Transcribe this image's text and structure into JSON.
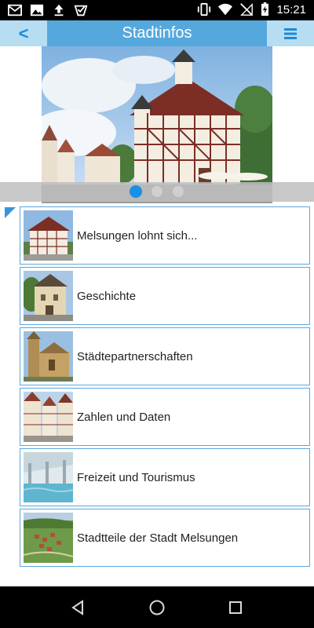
{
  "status_bar": {
    "time": "15:21",
    "left_icons": [
      "gmail-icon",
      "image-icon",
      "upload-icon",
      "check-badge-icon"
    ],
    "right_icons": [
      "vibrate-icon",
      "wifi-icon",
      "no-sim-icon",
      "battery-charging-icon"
    ]
  },
  "header": {
    "title": "Stadtinfos",
    "back_label": "<",
    "accent_color": "#55a8dc"
  },
  "slider": {
    "dot_count": 3,
    "active_index": 0
  },
  "list": {
    "items": [
      {
        "label": "Melsungen lohnt sich...",
        "thumb": "rathaus-thumbnail"
      },
      {
        "label": "Geschichte",
        "thumb": "historic-building-thumbnail"
      },
      {
        "label": "Städtepartnerschaften",
        "thumb": "church-thumbnail"
      },
      {
        "label": "Zahlen und Daten",
        "thumb": "street-thumbnail"
      },
      {
        "label": "Freizeit und Tourismus",
        "thumb": "pool-thumbnail"
      },
      {
        "label": "Stadtteile der Stadt Melsungen",
        "thumb": "village-thumbnail"
      }
    ]
  },
  "nav": {
    "buttons": [
      "back-nav-icon",
      "home-nav-icon",
      "recents-nav-icon"
    ]
  }
}
